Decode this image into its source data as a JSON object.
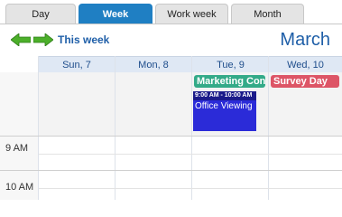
{
  "tabs": [
    {
      "label": "Day"
    },
    {
      "label": "Week"
    },
    {
      "label": "Work week"
    },
    {
      "label": "Month"
    }
  ],
  "nav": {
    "prev_icon": "green-left-arrow-icon",
    "next_icon": "green-right-arrow-icon",
    "label": "This week"
  },
  "month_title": "March",
  "days": [
    {
      "label": "Sun, 7"
    },
    {
      "label": "Mon, 8"
    },
    {
      "label": "Tue, 9"
    },
    {
      "label": "Wed, 10"
    }
  ],
  "all_day_events": [
    {
      "title": "Marketing Con",
      "color": "#33aa88"
    },
    {
      "title": "Survey Day",
      "color": "#dd5566"
    }
  ],
  "time_labels": [
    "9 AM",
    "10 AM"
  ],
  "timed_event": {
    "time": "9:00 AM - 10:00 AM",
    "title": "Office Viewing",
    "color": "#2b2bd8"
  },
  "colors": {
    "accent": "#1f7fc3",
    "title_text": "#1f5fa8",
    "nav_arrow": "#4caf2a"
  }
}
